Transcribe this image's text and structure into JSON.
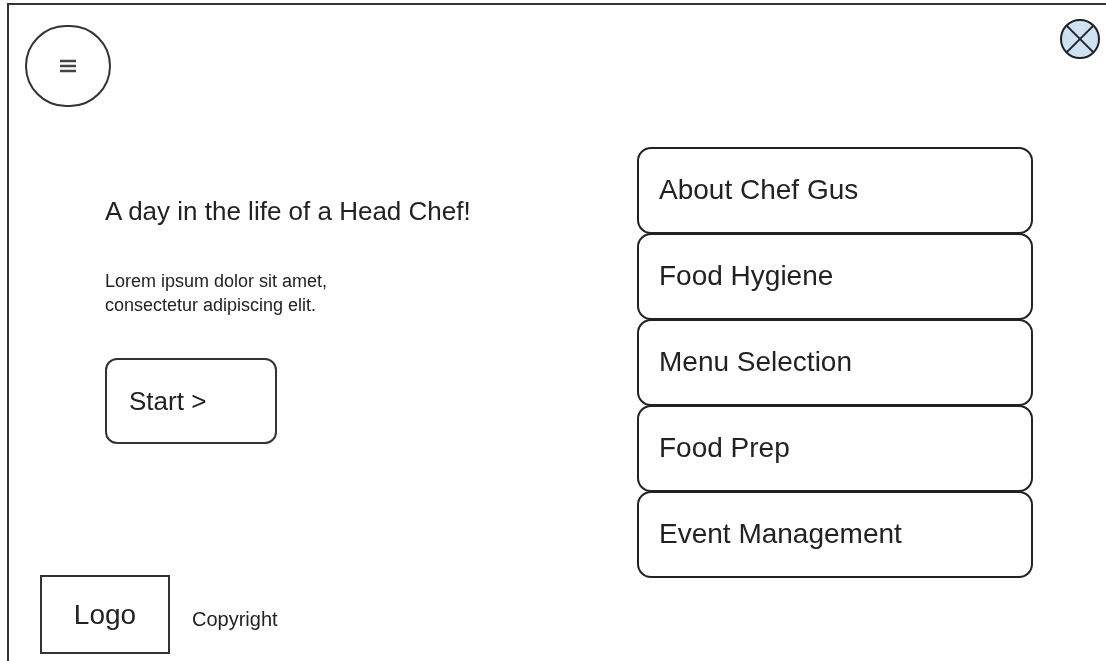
{
  "intro": {
    "title": "A day in the life of a Head Chef!",
    "text": "Lorem ipsum dolor sit amet,\nconsectetur adipiscing elit.",
    "button": "Start >"
  },
  "menu": [
    {
      "label": "About Chef Gus"
    },
    {
      "label": "Food Hygiene"
    },
    {
      "label": "Menu Selection"
    },
    {
      "label": "Food Prep"
    },
    {
      "label": "Event Management"
    }
  ],
  "footer": {
    "logo": "Logo",
    "copyright": "Copyright"
  }
}
